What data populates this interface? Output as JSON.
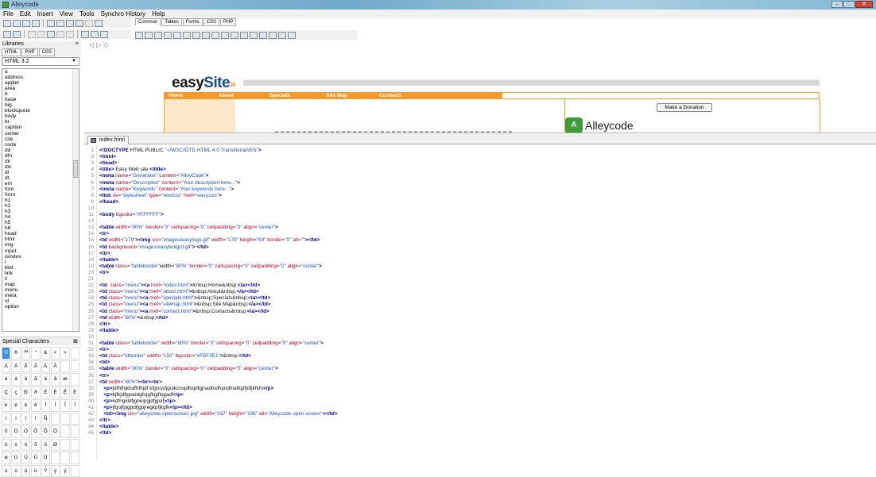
{
  "window": {
    "title": "Alleycode",
    "controls": [
      "–",
      "□",
      "✕"
    ]
  },
  "menu": [
    "File",
    "Edit",
    "Insert",
    "View",
    "Tools",
    "Synchro History",
    "Help"
  ],
  "tool_tabs": [
    "Common",
    "Tables",
    "Forms",
    "CSS",
    "PHP"
  ],
  "libraries": {
    "title": "Libraries",
    "close": "×",
    "tabs": [
      "HTML",
      "PHP",
      "CSS"
    ],
    "version": "HTML 3.2",
    "items": [
      "a",
      "address",
      "applet",
      "area",
      "b",
      "base",
      "big",
      "blockquote",
      "body",
      "br",
      "caption",
      "center",
      "cite",
      "code",
      "dd",
      "dfn",
      "dir",
      "div",
      "dl",
      "dt",
      "em",
      "font",
      "form",
      "h1",
      "h2",
      "h3",
      "h4",
      "h5",
      "h6",
      "head",
      "html",
      "img",
      "input",
      "isindex",
      "i",
      "kbd",
      "link",
      "li",
      "map",
      "menu",
      "meta",
      "ol",
      "option"
    ]
  },
  "special_chars": {
    "title": "Special Characters",
    "chars": [
      "©",
      "®",
      "™",
      "\"",
      "&",
      "<",
      ">",
      "",
      "À",
      "Á",
      "Â",
      "Ã",
      "Ä",
      "Å",
      "",
      "",
      "à",
      "á",
      "â",
      "ã",
      "ä",
      "å",
      "æ",
      "",
      "Ç",
      "ç",
      "Ð",
      "ð",
      "È",
      "É",
      "Ê",
      "Ë",
      "è",
      "é",
      "ê",
      "ë",
      "Ì",
      "Í",
      "Î",
      "Ï",
      "ì",
      "í",
      "î",
      "ï",
      "Ñ",
      "",
      "",
      "",
      "ñ",
      "Ò",
      "Ó",
      "Ô",
      "Õ",
      "Ö",
      "",
      "",
      "ò",
      "ó",
      "ô",
      "õ",
      "ö",
      "Ø",
      "",
      "",
      "ø",
      "Ù",
      "Ú",
      "Û",
      "Ü",
      "",
      "",
      "",
      "ù",
      "ú",
      "û",
      "ü",
      "Ý",
      "ý",
      "ÿ",
      ""
    ]
  },
  "preview": {
    "logo_easy": "easy",
    "logo_site": "Site",
    "logo_chev": "»",
    "menu": [
      "Home",
      "About",
      "Specials",
      "Site Map",
      "Contacts"
    ],
    "donate": "Make a Donation",
    "alley_mark": "A",
    "alley_text": "Alleycode"
  },
  "editor": {
    "tab": "index.html",
    "lines": [
      "<!DOCTYPE HTML PUBLIC \"-//W3C//DTD HTML 4.0 Transitional//EN\">",
      "<html>",
      "<head>",
      "<title> Easy Web site </title>",
      "<meta name=\"Generator\" content=\"AlleyCode\">",
      "<meta name=\"Description\" content=\"Your description here...\">",
      "<meta name=\"Keywords\" content=\"Your keywords here...\">",
      "<link rel=\"stylesheet\" type=\"text/css\" href=\"easy.css\">",
      "</head>",
      "",
      "<body bgcolor=\"#FFFFFF\">",
      "",
      "<table width=\"80%\" border=\"0\" cellspacing=\"0\" cellpadding=\"0\" align=\"center\">",
      "<tr>",
      "<td width=\"179\"><img src=\"images/easylogo.gif\" width=\"179\" height=\"63\" border=\"0\" alt=\"\"></td>",
      "<td background=\"images/easybckgrd.gif\"> </td>",
      "</tr>",
      "</table>",
      "<table class=\"tableborder\"width=\"80%\" border=\"0\" cellspacing=\"0\" cellpadding=\"0\" align=\"center\">",
      "<tr>",
      "",
      "<td  class=\"menu\"><a href=\"index.html\">&nbsp;Home&nbsp;</a></td>",
      "<td class=\"menu\"><a href=\"about.html\">&nbsp;About&nbsp;</a></td>",
      "<td class=\"menu\"><a href=\"specials.html\">&nbsp;Specials&nbsp;</a></td>",
      "<td class=\"menu\"><a href=\"sitemap.html\">&nbsp;Site Map&nbsp;</a></td>",
      "<td class=\"menu\"><a href=\"contact.html\">&nbsp;Contacts&nbsp;</a></td>",
      "<td width=\"60%\">&nbsp;</td>",
      "</tr>",
      "</table>",
      "",
      "<table class=\"tableborder\" width=\"80%\" border=\"0\" cellspacing=\"0\" cellpadding=\"0\" align=\"center\">",
      "<tr>",
      "<td class=\"tdborder\" width=\"150\" bgcolor=\"#FBF3E1\">&nbsp;</td>",
      "<td>",
      "<table width=\"90%\" border=\"0\" cellspacing=\"0\" cellpadding=\"0\" align=\"center\">",
      "<tr>",
      "<td width=\"60%\"><br><br>",
      "   <p>jdfhfhjkhdfhfhjdf kfgnosfjgoikcosjdfoijdfgjnadfodfojndfnafkjdfjdfjkfkfn</p>",
      "   <p>kjfkjdfjgoeidgfojgfkgjfkgjadf</p>",
      "   <p>kdfngkldfjgoeijrgjdfjgoifj</p>",
      "   <p>jfgojfpjgpdfjgpjregkpfjkgfk</p></td>",
      "   <td><img src=\"alleycode-openscreen.jpg\" width=\"337\" height=\"196\" alt=\"Alleycode open screen\"></td>",
      "</tr>",
      "</table>",
      "</td>"
    ]
  }
}
